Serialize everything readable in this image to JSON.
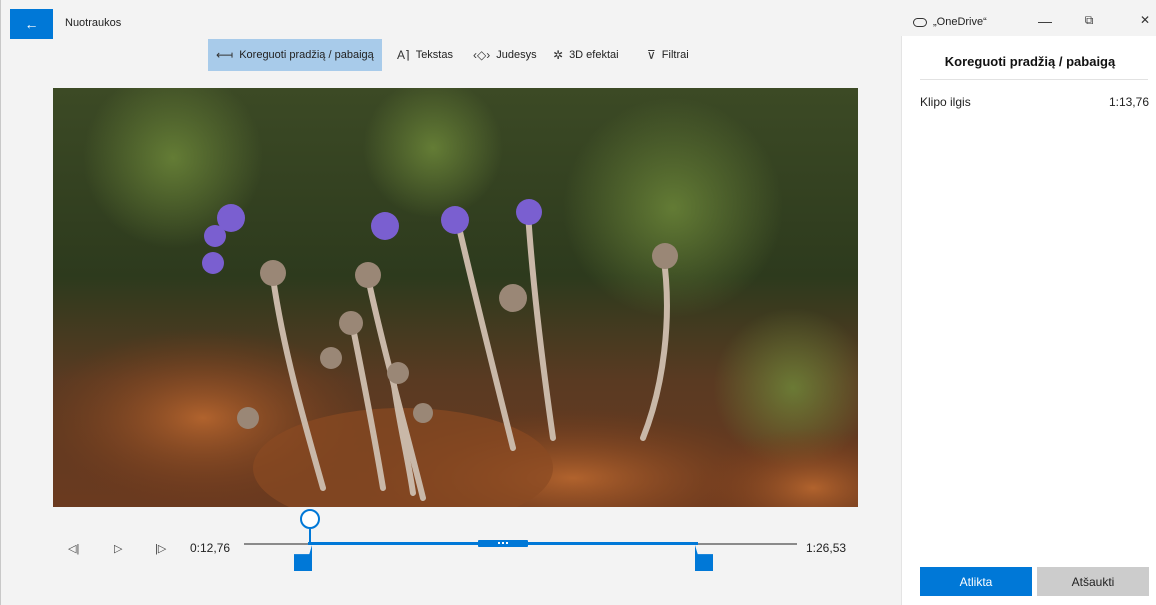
{
  "app": {
    "title": "Nuotraukos",
    "back_icon": "back-arrow-icon"
  },
  "window": {
    "onedrive_label": "„OneDrive“",
    "minimize": "—",
    "maximize": "⧉",
    "close": "✕"
  },
  "toolbar": {
    "items": [
      {
        "label": "Koreguoti pradžią / pabaigą",
        "icon": "trim-icon",
        "active": true
      },
      {
        "label": "Tekstas",
        "icon": "text-icon",
        "active": false
      },
      {
        "label": "Judesys",
        "icon": "motion-icon",
        "active": false
      },
      {
        "label": "3D efektai",
        "icon": "3d-effects-icon",
        "active": false
      },
      {
        "label": "Filtrai",
        "icon": "filters-icon",
        "active": false
      }
    ]
  },
  "timeline": {
    "start_time": "0:12,76",
    "end_time": "1:26,53",
    "prev_frame": "◁|",
    "play": "▷",
    "next_frame": "|▷"
  },
  "panel": {
    "title": "Koreguoti pradžią / pabaigą",
    "clip_length_label": "Klipo ilgis",
    "clip_length_value": "1:13,76",
    "done_label": "Atlikta",
    "cancel_label": "Atšaukti"
  },
  "colors": {
    "accent": "#0078d7",
    "active_tool": "#a8cbea"
  }
}
